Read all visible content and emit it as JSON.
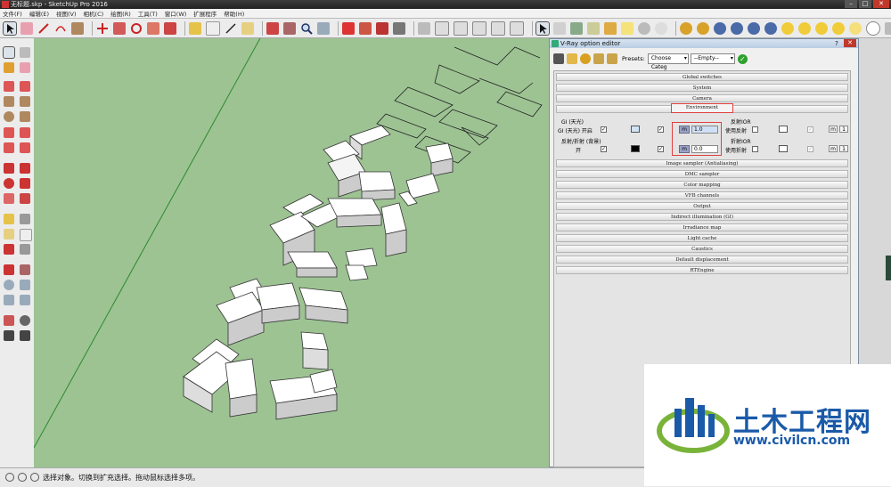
{
  "window": {
    "title": "无标题.skp - SketchUp Pro 2016"
  },
  "menu": [
    "文件(F)",
    "编辑(E)",
    "视图(V)",
    "相机(C)",
    "绘图(R)",
    "工具(T)",
    "窗口(W)",
    "扩展程序",
    "帮助(H)"
  ],
  "status": {
    "text": "选择对象。切换到扩充选择。拖动鼠标选择多项。"
  },
  "vray": {
    "title": "V-Ray option editor",
    "help": "?",
    "presets_label": "Presets:",
    "preset_category": "Choose Categ",
    "preset_value": "--Empty--",
    "sections_top": [
      "Global switches",
      "System",
      "Camera"
    ],
    "environment": "Environment",
    "env": {
      "gi_header": "GI (天光)",
      "gi_on": "GI (天光) 开启",
      "refl_header": "反射/折射 (背景)",
      "refl_on": "开",
      "gi_value": "1.0",
      "refl_value": "0.0",
      "m_label": "m",
      "reflect_ior": "反射IOR",
      "use_reflect": "使用反射",
      "refract_ior": "折射IOR",
      "use_refract": "使用折射"
    },
    "sections_bottom": [
      "Image sampler (Antialiasing)",
      "DMC sampler",
      "Color mapping",
      "VFB channels",
      "Output",
      "Indirect illumination (GI)",
      "Irradiance map",
      "Light cache",
      "Caustics",
      "Default displacement",
      "RTEngine"
    ]
  },
  "watermark": {
    "name": "土木工程网",
    "url": "www.civilcn.com"
  }
}
